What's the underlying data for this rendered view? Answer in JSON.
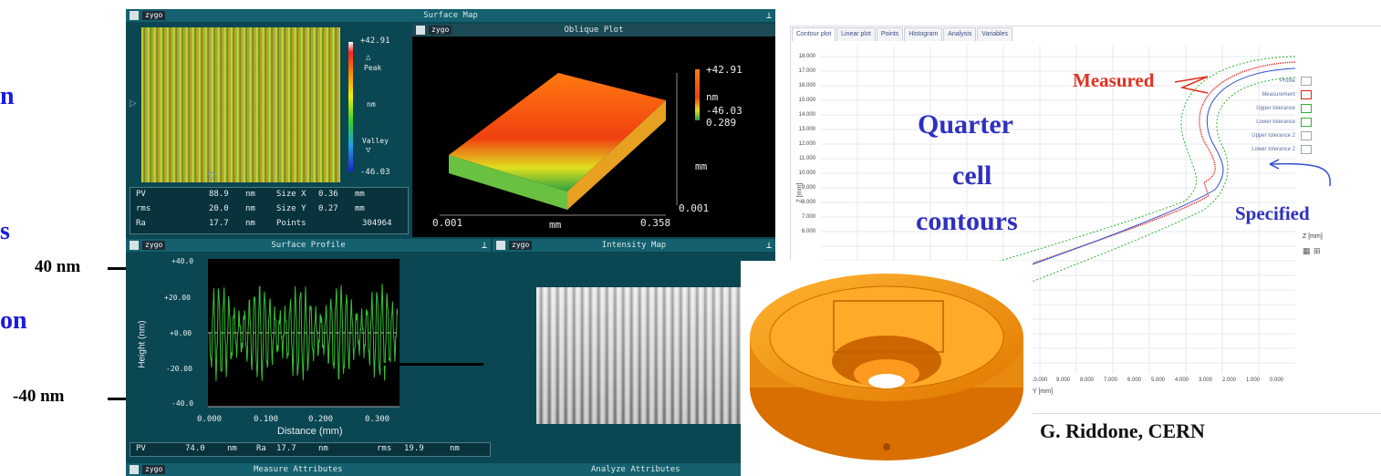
{
  "left_labels": {
    "nm_top": "40 nm",
    "nm_bottom": "-40 nm",
    "frag1": "n",
    "frag2": "s",
    "frag3": "on"
  },
  "surface_map": {
    "title": "Surface Map",
    "brand": "zygo",
    "scale": {
      "max": "+42.91",
      "peak": "Peak",
      "unit": "nm",
      "valley": "Valley",
      "min": "-46.03"
    },
    "stats": [
      {
        "label": "PV",
        "value": "88.9",
        "unit": "nm",
        "label2": "Size X",
        "value2": "0.36",
        "unit2": "mm"
      },
      {
        "label": "rms",
        "value": "20.0",
        "unit": "nm",
        "label2": "Size Y",
        "value2": "0.27",
        "unit2": "mm"
      },
      {
        "label": "Ra",
        "value": "17.7",
        "unit": "nm",
        "label2": "Points",
        "value2": "304964",
        "unit2": ""
      }
    ]
  },
  "oblique_plot": {
    "title": "Oblique Plot",
    "brand": "zygo",
    "max": "+42.91",
    "unit": "nm",
    "min": "-46.03",
    "z": "0.289",
    "axis_unit_right": "mm",
    "right_min": "0.001",
    "x_min": "0.001",
    "x_unit": "mm",
    "x_max": "0.358"
  },
  "surface_profile": {
    "title": "Surface Profile",
    "brand": "zygo",
    "y_ticks": [
      "+40.0",
      "+20.00",
      "+0.00",
      "-20.00",
      "-40.0"
    ],
    "ylabel": "Height (nm)",
    "x_ticks": [
      "0.000",
      "0.100",
      "0.200",
      "0.300"
    ],
    "xlabel": "Distance (mm)",
    "stats": {
      "pv": "PV",
      "pv_val": "74.0",
      "pv_unit": "nm",
      "ra": "Ra",
      "ra_val": "17.7",
      "ra_unit": "nm",
      "rms": "rms",
      "rms_val": "19.9",
      "rms_unit": "nm"
    }
  },
  "intensity_map": {
    "title": "Intensity Map",
    "brand": "zygo"
  },
  "bottom_bar": {
    "left": "Measure Attributes",
    "right": "Analyze Attributes",
    "brand": "zygo"
  },
  "contour_app": {
    "tabs": [
      "Contour plot",
      "Linear plot",
      "Points",
      "Histogram",
      "Analysis",
      "Variables"
    ],
    "y_ticks": [
      "18.000",
      "17.000",
      "16.000",
      "15.000",
      "14.000",
      "13.000",
      "12.000",
      "11.000",
      "10.000",
      "9.000",
      "8.000",
      "7.000",
      "6.000"
    ],
    "ylabel": "Z [mm]",
    "x_ticks": [
      "10.000",
      "9.000",
      "8.000",
      "7.000",
      "6.000",
      "5.000",
      "4.000",
      "3.000",
      "2.000",
      "1.000",
      "0.000"
    ],
    "xlabel": "Y [mm]",
    "legend": [
      "Profile",
      "Measurement",
      "Upper tolerance",
      "Lower tolerance",
      "Upper tolerance 2",
      "Lower tolerance 2"
    ],
    "side_label": "Z [mm]",
    "colors": {
      "measured": "#e02020",
      "specified": "#3050d0",
      "tolerance": "#30b030"
    }
  },
  "annotations": {
    "quarter": "Quarter",
    "cell": "cell",
    "contours": "contours",
    "measured": "Measured",
    "specified": "Specified",
    "credit": "G. Riddone, CERN"
  }
}
